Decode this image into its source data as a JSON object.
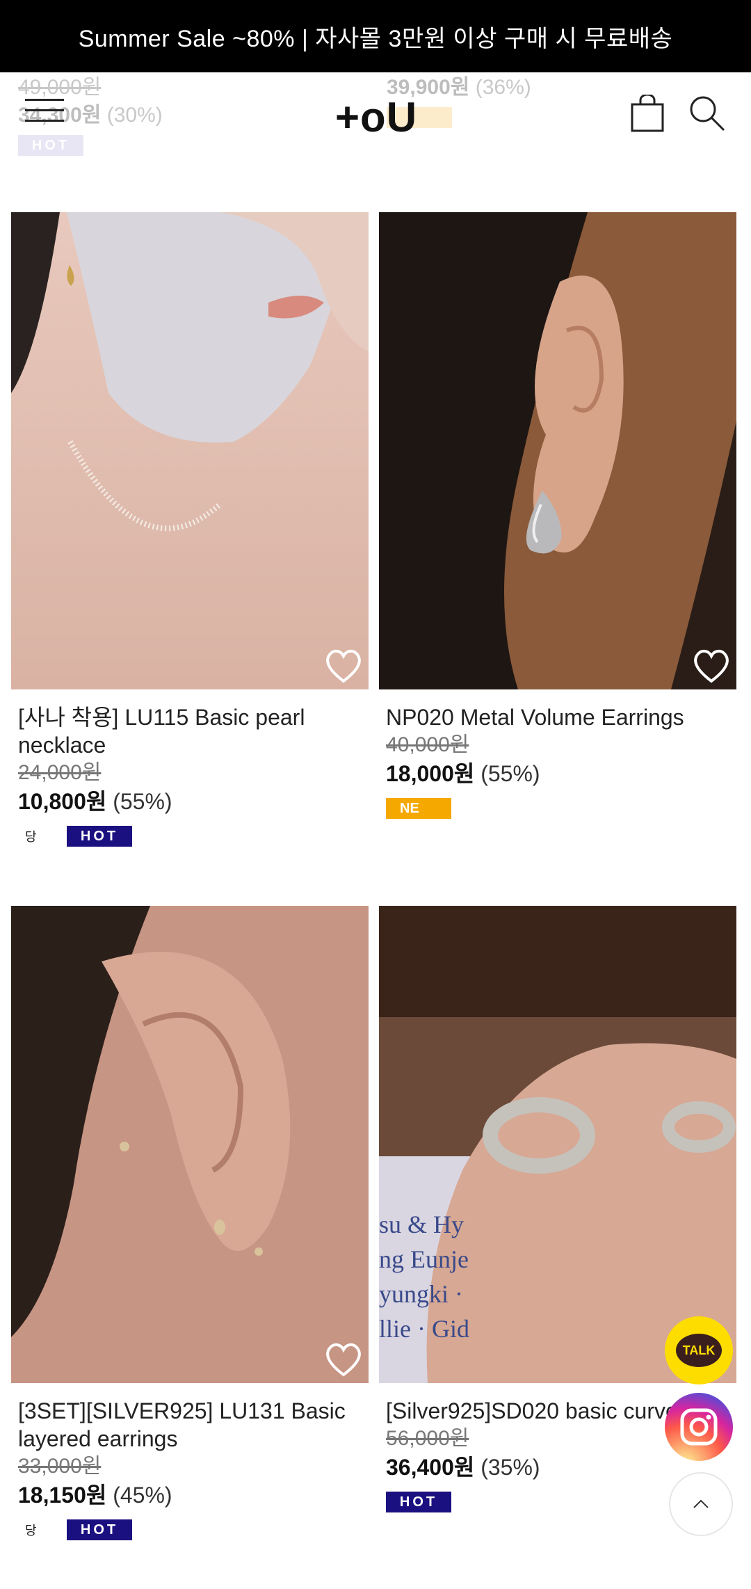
{
  "banner": {
    "text": "Summer Sale ~80%  |  자사몰 3만원 이상 구매 시 무료배송"
  },
  "header": {
    "logo": "+oU"
  },
  "prev_row": {
    "left_orig": "49,000원",
    "left_price": "34,300원",
    "left_discount": "(30%)",
    "left_badge": "HOT",
    "right_price": "39,900원",
    "right_discount": "(36%)"
  },
  "products": [
    {
      "name": "[사나 착용] LU115 Basic pearl necklace",
      "orig": "24,000원",
      "price": "10,800원",
      "discount": "(55%)",
      "badges": [
        "당",
        "HOT"
      ]
    },
    {
      "name": "NP020 Metal Volume Earrings",
      "orig": "40,000원",
      "price": "18,000원",
      "discount": "(55%)",
      "badges": [
        "NE"
      ]
    },
    {
      "name": "[3SET][SILVER925] LU131 Basic layered earrings",
      "orig": "33,000원",
      "price": "18,150원",
      "discount": "(45%)",
      "badges": [
        "당",
        "HOT"
      ]
    },
    {
      "name": "[Silver925]SD020 basic curve ring",
      "orig": "56,000원",
      "price": "36,400원",
      "discount": "(35%)",
      "badges": [
        "HOT"
      ]
    }
  ],
  "fabs": {
    "talk": "TALK"
  },
  "colors": {
    "hot_badge": "#1a1080",
    "new_badge": "#f5a800",
    "kakao": "#fddc00",
    "banner_bg": "#000000"
  }
}
